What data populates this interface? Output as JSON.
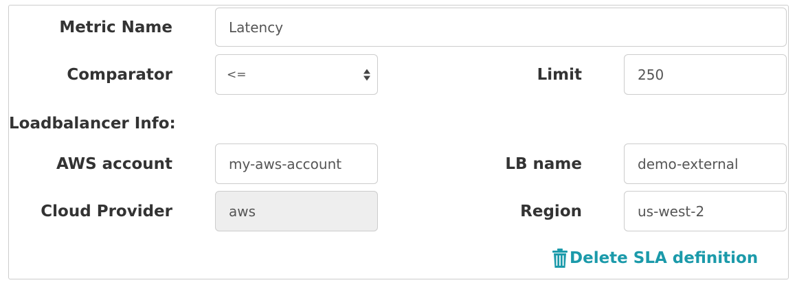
{
  "form": {
    "metric_name": {
      "label": "Metric Name",
      "value": "Latency"
    },
    "comparator": {
      "label": "Comparator",
      "value": "<="
    },
    "limit": {
      "label": "Limit",
      "value": "250"
    },
    "section_title": "Loadbalancer Info:",
    "aws_account": {
      "label": "AWS account",
      "value": "my-aws-account"
    },
    "lb_name": {
      "label": "LB name",
      "value": "demo-external"
    },
    "cloud_provider": {
      "label": "Cloud Provider",
      "value": "aws"
    },
    "region": {
      "label": "Region",
      "value": "us-west-2"
    },
    "delete": {
      "label": "Delete SLA definition",
      "icon": "trash-icon"
    }
  },
  "colors": {
    "link": "#1b9aaa",
    "border": "#cccccc",
    "disabled_bg": "#eeeeee"
  }
}
